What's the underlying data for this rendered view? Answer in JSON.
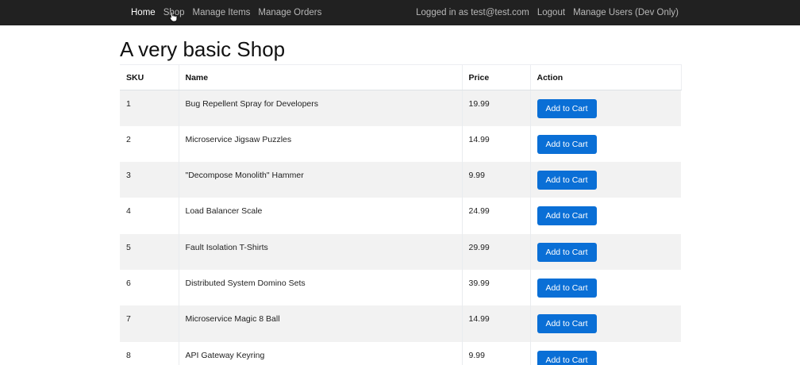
{
  "nav": {
    "home": "Home",
    "shop": "Shop",
    "manage_items": "Manage Items",
    "manage_orders": "Manage Orders",
    "logged_in": "Logged in as test@test.com",
    "logout": "Logout",
    "manage_users": "Manage Users (Dev Only)"
  },
  "page": {
    "title": "A very basic Shop"
  },
  "table": {
    "headers": {
      "sku": "SKU",
      "name": "Name",
      "price": "Price",
      "action": "Action"
    },
    "rows": [
      {
        "sku": "1",
        "name": "Bug Repellent Spray for Developers",
        "price": "19.99",
        "action": "Add to Cart"
      },
      {
        "sku": "2",
        "name": "Microservice Jigsaw Puzzles",
        "price": "14.99",
        "action": "Add to Cart"
      },
      {
        "sku": "3",
        "name": "\"Decompose Monolith\" Hammer",
        "price": "9.99",
        "action": "Add to Cart"
      },
      {
        "sku": "4",
        "name": "Load Balancer Scale",
        "price": "24.99",
        "action": "Add to Cart"
      },
      {
        "sku": "5",
        "name": "Fault Isolation T-Shirts",
        "price": "29.99",
        "action": "Add to Cart"
      },
      {
        "sku": "6",
        "name": "Distributed System Domino Sets",
        "price": "39.99",
        "action": "Add to Cart"
      },
      {
        "sku": "7",
        "name": "Microservice Magic 8 Ball",
        "price": "14.99",
        "action": "Add to Cart"
      },
      {
        "sku": "8",
        "name": "API Gateway Keyring",
        "price": "9.99",
        "action": "Add to Cart"
      }
    ]
  },
  "colors": {
    "navbar_bg": "#212121",
    "button_bg": "#0a6fd6",
    "row_stripe": "#f2f2f2"
  },
  "icons": {
    "cursor": "hand-pointer-icon"
  }
}
